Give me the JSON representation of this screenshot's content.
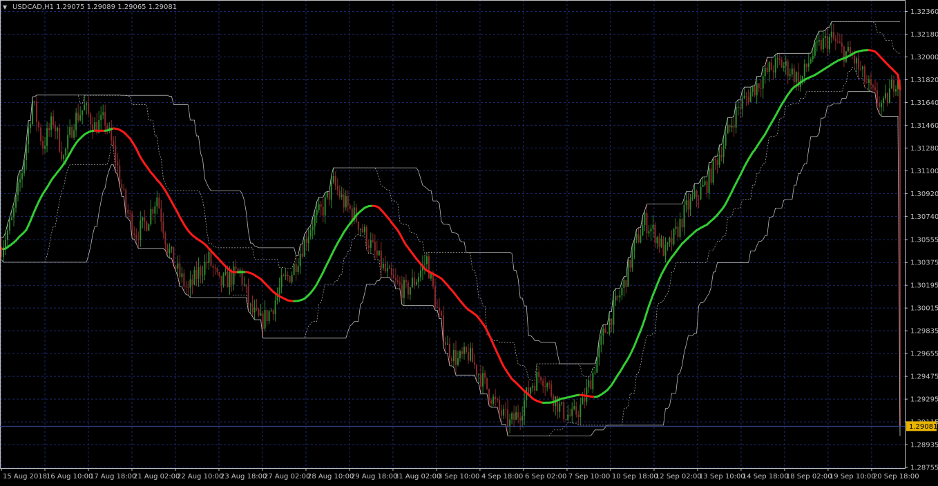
{
  "window": {
    "title": "USDCAD,H1  1.29075 1.29089 1.29065 1.29081",
    "arrow_glyph": "▼"
  },
  "colors": {
    "background": "#000000",
    "frame": "#c0c0c0",
    "grid": "#1e2a6e",
    "bull_candle": "#2f8a2f",
    "bear_candle": "#8b2a2a",
    "channel_line": "#b8b8b8",
    "trend_up": "#33cc33",
    "trend_down": "#ff1a1a",
    "price_line": "#3a4fa8",
    "price_tag_bg": "#e8b400",
    "price_tag_text": "#000000",
    "axis_text": "#c0c0c0"
  },
  "chart_data": {
    "type": "candlestick",
    "symbol": "USDCAD",
    "timeframe": "H1",
    "ohlc_last": {
      "open": 1.29075,
      "high": 1.29089,
      "low": 1.29065,
      "close": 1.29081
    },
    "current_price": 1.29081,
    "current_price_label": "1.29081",
    "ylim": [
      1.2875,
      1.3245
    ],
    "y_ticks": [
      "1.32360",
      "1.32180",
      "1.32000",
      "1.31820",
      "1.31640",
      "1.31460",
      "1.31280",
      "1.31100",
      "1.30920",
      "1.30740",
      "1.30555",
      "1.30375",
      "1.30195",
      "1.30015",
      "1.29835",
      "1.29655",
      "1.29475",
      "1.29295",
      "1.29115",
      "1.28935",
      "1.28755"
    ],
    "x_ticks": [
      "15 Aug 2018",
      "16 Aug 10:00",
      "17 Aug 18:00",
      "21 Aug 02:00",
      "22 Aug 10:00",
      "23 Aug 18:00",
      "27 Aug 02:00",
      "28 Aug 10:00",
      "29 Aug 18:00",
      "31 Aug 02:00",
      "3 Sep 10:00",
      "4 Sep 18:00",
      "6 Sep 02:00",
      "7 Sep 10:00",
      "10 Sep 18:00",
      "12 Sep 02:00",
      "13 Sep 10:00",
      "14 Sep 18:00",
      "18 Sep 02:00",
      "19 Sep 10:00",
      "20 Sep 18:00"
    ],
    "bar_count": 434,
    "price_path": [
      [
        0,
        1.305
      ],
      [
        5,
        1.307
      ],
      [
        10,
        1.311
      ],
      [
        15,
        1.3165
      ],
      [
        20,
        1.313
      ],
      [
        25,
        1.315
      ],
      [
        30,
        1.312
      ],
      [
        35,
        1.315
      ],
      [
        40,
        1.316
      ],
      [
        45,
        1.3145
      ],
      [
        50,
        1.315
      ],
      [
        55,
        1.312
      ],
      [
        60,
        1.308
      ],
      [
        65,
        1.306
      ],
      [
        70,
        1.307
      ],
      [
        75,
        1.309
      ],
      [
        80,
        1.305
      ],
      [
        85,
        1.303
      ],
      [
        90,
        1.3015
      ],
      [
        95,
        1.303
      ],
      [
        100,
        1.304
      ],
      [
        105,
        1.302
      ],
      [
        110,
        1.3025
      ],
      [
        115,
        1.303
      ],
      [
        120,
        1.3
      ],
      [
        125,
        1.299
      ],
      [
        130,
        1.3
      ],
      [
        135,
        1.302
      ],
      [
        140,
        1.303
      ],
      [
        145,
        1.305
      ],
      [
        150,
        1.307
      ],
      [
        155,
        1.308
      ],
      [
        160,
        1.31
      ],
      [
        165,
        1.3085
      ],
      [
        170,
        1.3075
      ],
      [
        175,
        1.306
      ],
      [
        180,
        1.3045
      ],
      [
        185,
        1.303
      ],
      [
        190,
        1.302
      ],
      [
        195,
        1.3015
      ],
      [
        200,
        1.3025
      ],
      [
        205,
        1.304
      ],
      [
        210,
        1.3
      ],
      [
        215,
        1.297
      ],
      [
        220,
        1.296
      ],
      [
        225,
        1.2965
      ],
      [
        230,
        1.295
      ],
      [
        235,
        1.2935
      ],
      [
        240,
        1.292
      ],
      [
        245,
        1.291
      ],
      [
        250,
        1.292
      ],
      [
        255,
        1.294
      ],
      [
        260,
        1.295
      ],
      [
        265,
        1.2935
      ],
      [
        270,
        1.292
      ],
      [
        275,
        1.2915
      ],
      [
        280,
        1.2925
      ],
      [
        285,
        1.295
      ],
      [
        290,
        1.298
      ],
      [
        295,
        1.3
      ],
      [
        300,
        1.302
      ],
      [
        305,
        1.305
      ],
      [
        310,
        1.307
      ],
      [
        315,
        1.306
      ],
      [
        320,
        1.3045
      ],
      [
        325,
        1.306
      ],
      [
        330,
        1.308
      ],
      [
        335,
        1.309
      ],
      [
        340,
        1.31
      ],
      [
        345,
        1.312
      ],
      [
        350,
        1.314
      ],
      [
        355,
        1.316
      ],
      [
        360,
        1.317
      ],
      [
        365,
        1.318
      ],
      [
        370,
        1.319
      ],
      [
        375,
        1.3195
      ],
      [
        380,
        1.319
      ],
      [
        385,
        1.318
      ],
      [
        390,
        1.32
      ],
      [
        395,
        1.321
      ],
      [
        400,
        1.3215
      ],
      [
        405,
        1.3205
      ],
      [
        410,
        1.32
      ],
      [
        415,
        1.3185
      ],
      [
        420,
        1.317
      ],
      [
        425,
        1.316
      ],
      [
        430,
        1.318
      ],
      [
        434,
        1.319
      ]
    ]
  }
}
